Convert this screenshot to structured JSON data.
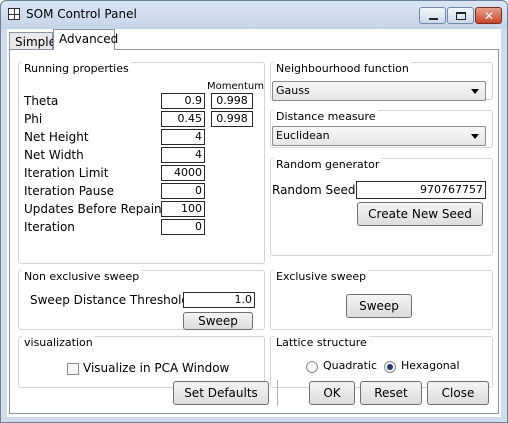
{
  "window": {
    "title": "SOM Control Panel"
  },
  "tabs": [
    {
      "label": "Simple",
      "selected": false
    },
    {
      "label": "Advanced",
      "selected": true
    }
  ],
  "running_properties": {
    "title": "Running properties",
    "momentum_header": "Momentum",
    "rows": [
      {
        "label": "Theta",
        "value": "0.9",
        "momentum": "0.998"
      },
      {
        "label": "Phi",
        "value": "0.45",
        "momentum": "0.998"
      },
      {
        "label": "Net Height",
        "value": "4"
      },
      {
        "label": "Net Width",
        "value": "4"
      },
      {
        "label": "Iteration Limit",
        "value": "4000"
      },
      {
        "label": "Iteration Pause",
        "value": "0"
      },
      {
        "label": "Updates Before Repaint",
        "value": "100"
      },
      {
        "label": "Iteration",
        "value": "0"
      }
    ]
  },
  "neighbourhood": {
    "title": "Neighbourhood function",
    "selected": "Gauss"
  },
  "distance": {
    "title": "Distance measure",
    "selected": "Euclidean"
  },
  "random_generator": {
    "title": "Random generator",
    "seed_label": "Random Seed",
    "seed_value": "970767757",
    "new_seed_button": "Create New Seed"
  },
  "non_exclusive_sweep": {
    "title": "Non exclusive sweep",
    "threshold_label": "Sweep Distance Threshold",
    "threshold_value": "1.0",
    "sweep_button": "Sweep"
  },
  "exclusive_sweep": {
    "title": "Exclusive sweep",
    "sweep_button": "Sweep"
  },
  "visualization": {
    "title": "visualization",
    "pca_label": "Visualize in PCA Window",
    "pca_checked": false
  },
  "lattice": {
    "title": "Lattice structure",
    "options": [
      "Quadratic",
      "Hexagonal"
    ],
    "selected": "Hexagonal"
  },
  "footer": {
    "set_defaults": "Set Defaults",
    "ok": "OK",
    "reset": "Reset",
    "close": "Close"
  },
  "colors": {
    "window_frame": "#cfdcec",
    "close_button": "#c4472d"
  }
}
